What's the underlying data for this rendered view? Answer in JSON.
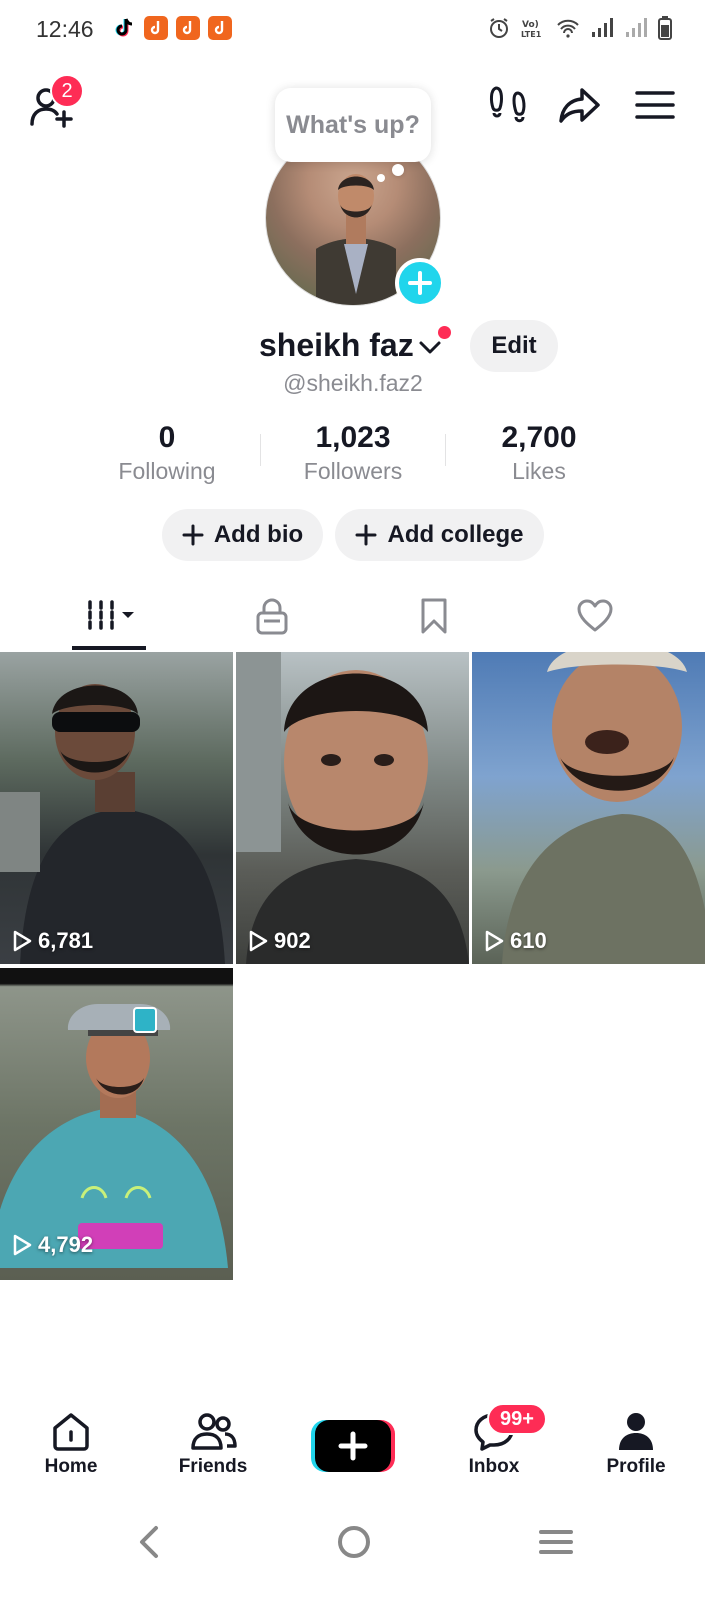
{
  "status_bar": {
    "time": "12:46",
    "network_label": "Vo) LTE1"
  },
  "top_bar": {
    "add_friend_badge": "2",
    "icons": [
      "add-friend-icon",
      "footprints-icon",
      "share-icon",
      "menu-icon"
    ]
  },
  "profile": {
    "bubble_text": "What's up?",
    "display_name": "sheikh faz",
    "handle": "@sheikh.faz2",
    "edit_label": "Edit"
  },
  "stats": [
    {
      "value": "0",
      "label": "Following"
    },
    {
      "value": "1,023",
      "label": "Followers"
    },
    {
      "value": "2,700",
      "label": "Likes"
    }
  ],
  "actions": {
    "add_bio": "Add bio",
    "add_college": "Add college"
  },
  "tabs": [
    "videos-grid-icon",
    "lock-icon",
    "bookmark-icon",
    "heart-icon"
  ],
  "videos": [
    {
      "views": "6,781"
    },
    {
      "views": "902"
    },
    {
      "views": "610"
    },
    {
      "views": "4,792"
    }
  ],
  "bottom_nav": {
    "home": "Home",
    "friends": "Friends",
    "inbox": "Inbox",
    "inbox_badge": "99+",
    "profile": "Profile"
  },
  "colors": {
    "accent_red": "#fe2c55",
    "accent_cyan": "#20d5ec",
    "text_primary": "#161823",
    "text_secondary": "#8a8b91"
  }
}
